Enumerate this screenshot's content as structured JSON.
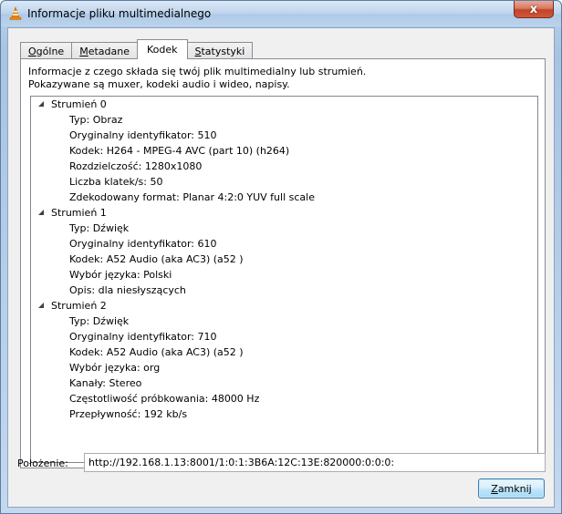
{
  "window": {
    "title": "Informacje pliku multimedialnego",
    "close_glyph": "x"
  },
  "tabs": [
    {
      "label": "Ogólne",
      "mnemonic": "O",
      "rest": "gólne",
      "active": false
    },
    {
      "label": "Metadane",
      "mnemonic": "M",
      "rest": "etadane",
      "active": false
    },
    {
      "label": "Kodek",
      "mnemonic": "",
      "rest": "Kodek",
      "active": true
    },
    {
      "label": "Statystyki",
      "mnemonic": "S",
      "rest": "tatystyki",
      "active": false
    }
  ],
  "description": {
    "line1": "Informacje z czego składa się twój plik multimedialny lub strumień.",
    "line2": "Pokazywane są muxer, kodeki audio i wideo, napisy."
  },
  "streams": [
    {
      "title": "Strumień 0",
      "expanded": true,
      "props": [
        "Typ: Obraz",
        "Oryginalny identyfikator: 510",
        "Kodek: H264 - MPEG-4 AVC (part 10) (h264)",
        "Rozdzielczość: 1280x1080",
        "Liczba klatek/s: 50",
        "Zdekodowany format: Planar 4:2:0 YUV full scale"
      ]
    },
    {
      "title": "Strumień 1",
      "expanded": true,
      "props": [
        "Typ: Dźwięk",
        "Oryginalny identyfikator: 610",
        "Kodek: A52 Audio (aka AC3) (a52 )",
        "Wybór języka: Polski",
        "Opis: dla niesłyszących"
      ]
    },
    {
      "title": "Strumień 2",
      "expanded": true,
      "props": [
        "Typ: Dźwięk",
        "Oryginalny identyfikator: 710",
        "Kodek: A52 Audio (aka AC3) (a52 )",
        "Wybór języka: org",
        "Kanały: Stereo",
        "Częstotliwość próbkowania: 48000 Hz",
        "Przepływność: 192 kb/s"
      ]
    }
  ],
  "location": {
    "label": "Położenie:",
    "value": "http://192.168.1.13:8001/1:0:1:3B6A:12C:13E:820000:0:0:0:"
  },
  "close_button": {
    "label": "Zamknij",
    "mnemonic": "Z",
    "rest": "amknij"
  },
  "colors": {
    "titlebar": "#c1d6ed",
    "close": "#c2442a",
    "dialog_bg": "#f0f0f0",
    "button": "#bee6fd",
    "vlc_orange": "#f08a12"
  },
  "icons": {
    "app": "vlc-cone-icon",
    "expander": "expanded-triangle-icon"
  }
}
